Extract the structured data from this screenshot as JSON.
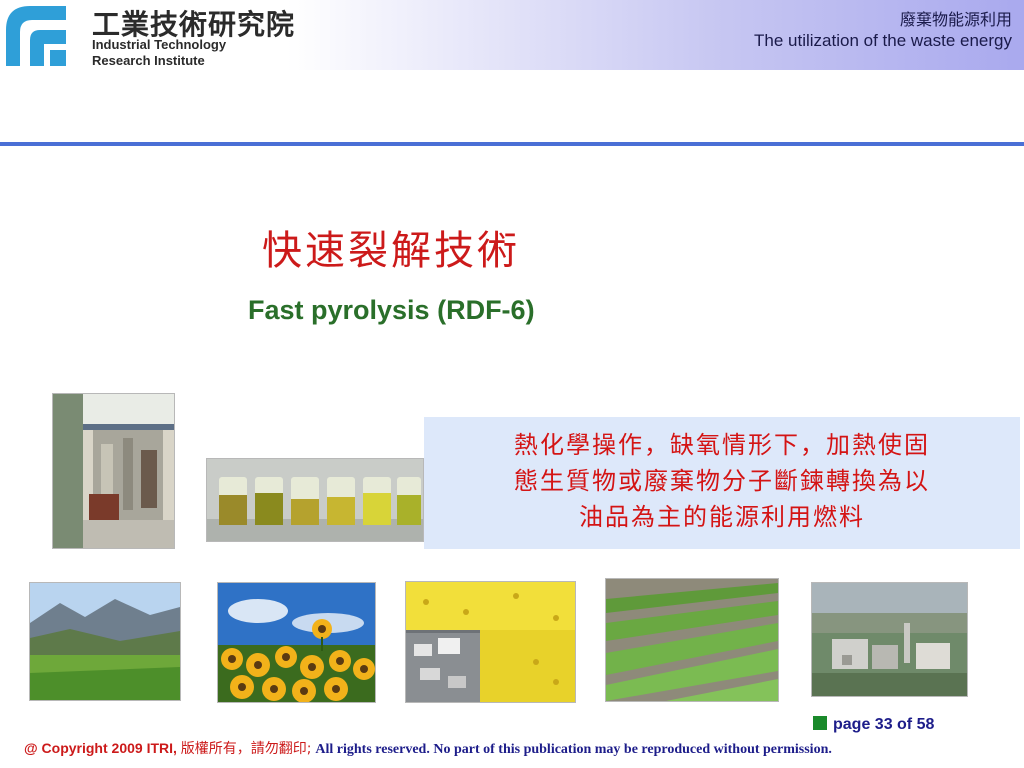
{
  "header": {
    "org_zh": "工業技術研究院",
    "org_en_line1": "Industrial Technology",
    "org_en_line2": "Research Institute",
    "topic_zh": "廢棄物能源利用",
    "topic_en": "The utilization of the waste energy"
  },
  "title": {
    "zh": "快速裂解技術",
    "en": "Fast pyrolysis (RDF-6)"
  },
  "description": {
    "lines": [
      "熱化學操作，缺氧情形下，加熱使固",
      "態生質物或廢棄物分子斷鍊轉換為以",
      "油品為主的能源利用燃料"
    ]
  },
  "footer": {
    "page_label": "page 33 of 58",
    "copyright_a": "@ Copyright 2009 ITRI,",
    "copyright_b": "版權所有，請勿翻印;",
    "copyright_c": "All rights reserved. No part of this publication may be reproduced without permission."
  },
  "colors": {
    "title_red": "#cc1a1a",
    "subtitle_green": "#2a6f2a",
    "rule_blue": "#4a6fd6",
    "box_blue": "#dde8fa"
  }
}
